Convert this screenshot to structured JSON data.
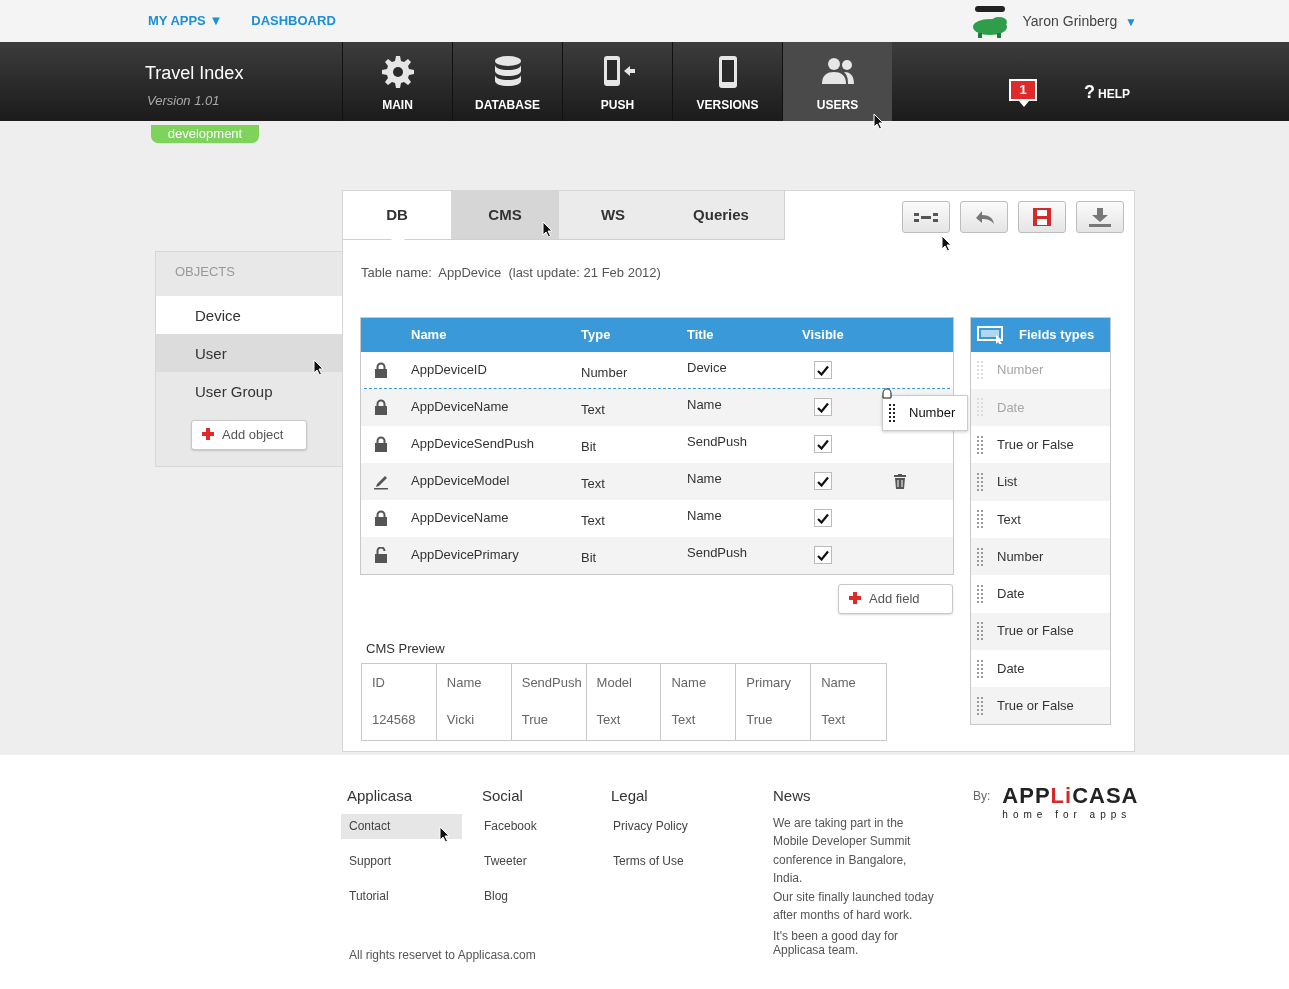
{
  "top_bar": {
    "links": [
      {
        "label": "MY APPS",
        "caret": "▼"
      },
      {
        "label": "DASHBOARD"
      }
    ],
    "user": {
      "name": "Yaron Grinberg",
      "caret": "▼"
    }
  },
  "app": {
    "title": "Travel Index",
    "version": "Version 1.01",
    "environment": "development"
  },
  "nav": [
    {
      "label": "MAIN",
      "kind": "gear",
      "selected": false,
      "pointer": false
    },
    {
      "label": "DATABASE",
      "kind": "database",
      "selected": false,
      "pointer": false
    },
    {
      "label": "PUSH",
      "kind": "push",
      "selected": false,
      "pointer": false
    },
    {
      "label": "VERSIONS",
      "kind": "phone",
      "selected": false,
      "pointer": false
    },
    {
      "label": "USERS",
      "kind": "users",
      "selected": true,
      "pointer": true
    }
  ],
  "notifications": {
    "count": "1"
  },
  "help": {
    "icon": "?",
    "label": "HELP"
  },
  "sidebar": {
    "heading": "OBJECTS",
    "items": [
      {
        "label": "Device",
        "selected": true,
        "hovered": false,
        "pointer": false
      },
      {
        "label": "User",
        "selected": false,
        "hovered": true,
        "pointer": true
      },
      {
        "label": "User Group",
        "selected": false,
        "hovered": false,
        "pointer": false
      }
    ],
    "add_button": {
      "label": "Add object"
    }
  },
  "tabs": [
    {
      "label": "DB",
      "selected": true,
      "hovered": false,
      "pointer": false
    },
    {
      "label": "CMS",
      "selected": false,
      "hovered": true,
      "pointer": true
    },
    {
      "label": "WS",
      "selected": false,
      "hovered": false,
      "pointer": false
    },
    {
      "label": "Queries",
      "selected": false,
      "hovered": false,
      "pointer": false
    }
  ],
  "toolbar": [
    {
      "kind": "layout",
      "pointer": true
    },
    {
      "kind": "undo"
    },
    {
      "kind": "save"
    },
    {
      "kind": "download"
    }
  ],
  "table_caption": "Table name:  AppDevice  (last update: 21 Feb 2012)",
  "table": {
    "columns": [
      "Name",
      "Type",
      "Title",
      "Visible"
    ],
    "rows": [
      {
        "kind": "locked",
        "name": "AppDeviceID",
        "type": "Number",
        "title": "Device",
        "visible": true,
        "drop_below": true
      },
      {
        "kind": "locked",
        "name": "AppDeviceName",
        "type": "Text",
        "title": "Name",
        "visible": true
      },
      {
        "kind": "locked",
        "name": "AppDeviceSendPush",
        "type": "Bit",
        "title": "SendPush",
        "visible": true
      },
      {
        "kind": "edit",
        "name": "AppDeviceModel",
        "type": "Text",
        "title": "Name",
        "visible": true,
        "deletable": true
      },
      {
        "kind": "locked",
        "name": "AppDeviceName",
        "type": "Text",
        "title": "Name",
        "visible": true
      },
      {
        "kind": "unlocked",
        "name": "AppDevicePrimary",
        "type": "Bit",
        "title": "SendPush",
        "visible": true
      }
    ]
  },
  "add_field": {
    "label": "Add field"
  },
  "field_types": {
    "title": "Fields types",
    "items": [
      {
        "label": "Number",
        "disabled": true
      },
      {
        "label": "Date",
        "disabled": true
      },
      {
        "label": "True or False",
        "disabled": false
      },
      {
        "label": "List",
        "disabled": false
      },
      {
        "label": "Text",
        "disabled": false
      },
      {
        "label": "Number",
        "disabled": false
      },
      {
        "label": "Date",
        "disabled": false
      },
      {
        "label": "True or False",
        "disabled": false
      },
      {
        "label": "Date",
        "disabled": false
      },
      {
        "label": "True or False",
        "disabled": false
      }
    ],
    "drag_ghost": {
      "label": "Number"
    }
  },
  "cms_preview": {
    "title": "CMS Preview",
    "columns": [
      {
        "header": "ID",
        "value": "124568"
      },
      {
        "header": "Name",
        "value": "Vicki"
      },
      {
        "header": "SendPush",
        "value": "True"
      },
      {
        "header": "Model",
        "value": "Text"
      },
      {
        "header": "Name",
        "value": "Text"
      },
      {
        "header": "Primary",
        "value": "True"
      },
      {
        "header": "Name",
        "value": "Text"
      }
    ]
  },
  "footer": {
    "columns": [
      {
        "title": "Applicasa",
        "links": [
          {
            "label": "Contact",
            "hovered": true,
            "pointer": true
          },
          {
            "label": "Support",
            "hovered": false,
            "pointer": false
          },
          {
            "label": "Tutorial",
            "hovered": false,
            "pointer": false
          }
        ]
      },
      {
        "title": "Social",
        "links": [
          {
            "label": "Facebook",
            "hovered": false,
            "pointer": false
          },
          {
            "label": "Tweeter",
            "hovered": false,
            "pointer": false
          },
          {
            "label": "Blog",
            "hovered": false,
            "pointer": false
          }
        ]
      },
      {
        "title": "Legal",
        "links": [
          {
            "label": "Privacy Policy",
            "hovered": false,
            "pointer": false
          },
          {
            "label": "Terms of Use",
            "hovered": false,
            "pointer": false
          }
        ]
      }
    ],
    "news": {
      "title": "News",
      "paragraphs": [
        "We are taking part in the\nMobile Developer Summit\nconference in Bangalore,\nIndia.",
        "Our site finally launched today\nafter months of hard work.",
        "It's been a good day for\nApplicasa team."
      ]
    },
    "copyright": "All rights reservet to Applicasa.com",
    "by": "By:",
    "logo": {
      "parts": [
        {
          "text": "APP",
          "color": "#222222"
        },
        {
          "text": "Li",
          "color": "#d42a2a"
        },
        {
          "text": "CASA",
          "color": "#222222"
        }
      ],
      "tagline": "home for apps"
    }
  }
}
